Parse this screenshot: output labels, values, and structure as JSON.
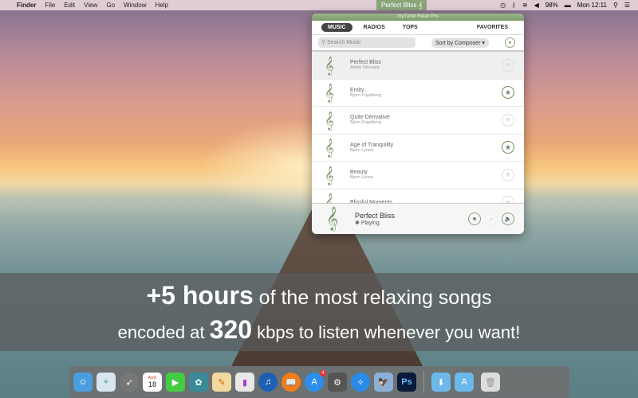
{
  "menubar": {
    "items": [
      "Finder",
      "File",
      "Edit",
      "View",
      "Go",
      "Window",
      "Help"
    ],
    "now_playing": "Perfect Bliss",
    "battery": "98%",
    "clock": "Mon 12:11"
  },
  "app": {
    "title": "myTuner Relax Pro",
    "tabs": [
      "MUSIC",
      "RADIOS",
      "TOPS"
    ],
    "favorites": "FAVORITES",
    "search_placeholder": "Search Music",
    "sort": "Sort by Composer",
    "songs": [
      {
        "title": "Perfect Bliss",
        "artist": "Adam Skorupa",
        "fav": false
      },
      {
        "title": "Entity",
        "artist": "Bjorn Fogelberg",
        "fav": true
      },
      {
        "title": "Quite Derivative",
        "artist": "Bjorn Fogelberg",
        "fav": false
      },
      {
        "title": "Age of Tranquility",
        "artist": "Bjorn Lynne",
        "fav": true
      },
      {
        "title": "Beauty",
        "artist": "Bjorn Lynne",
        "fav": false
      },
      {
        "title": "Blissful Moments",
        "artist": "",
        "fav": false
      }
    ],
    "player": {
      "title": "Perfect Bliss",
      "status": "Playing"
    }
  },
  "banner": {
    "l1_big": "+5 hours",
    "l1_rest": " of the most relaxing songs",
    "l2_a": "encoded at ",
    "l2_big": "320",
    "l2_b": " kbps to listen whenever you want!"
  },
  "dock": {
    "calendar_month": "AUG",
    "calendar_day": "18",
    "appstore_badge": "4",
    "ps": "Ps"
  }
}
